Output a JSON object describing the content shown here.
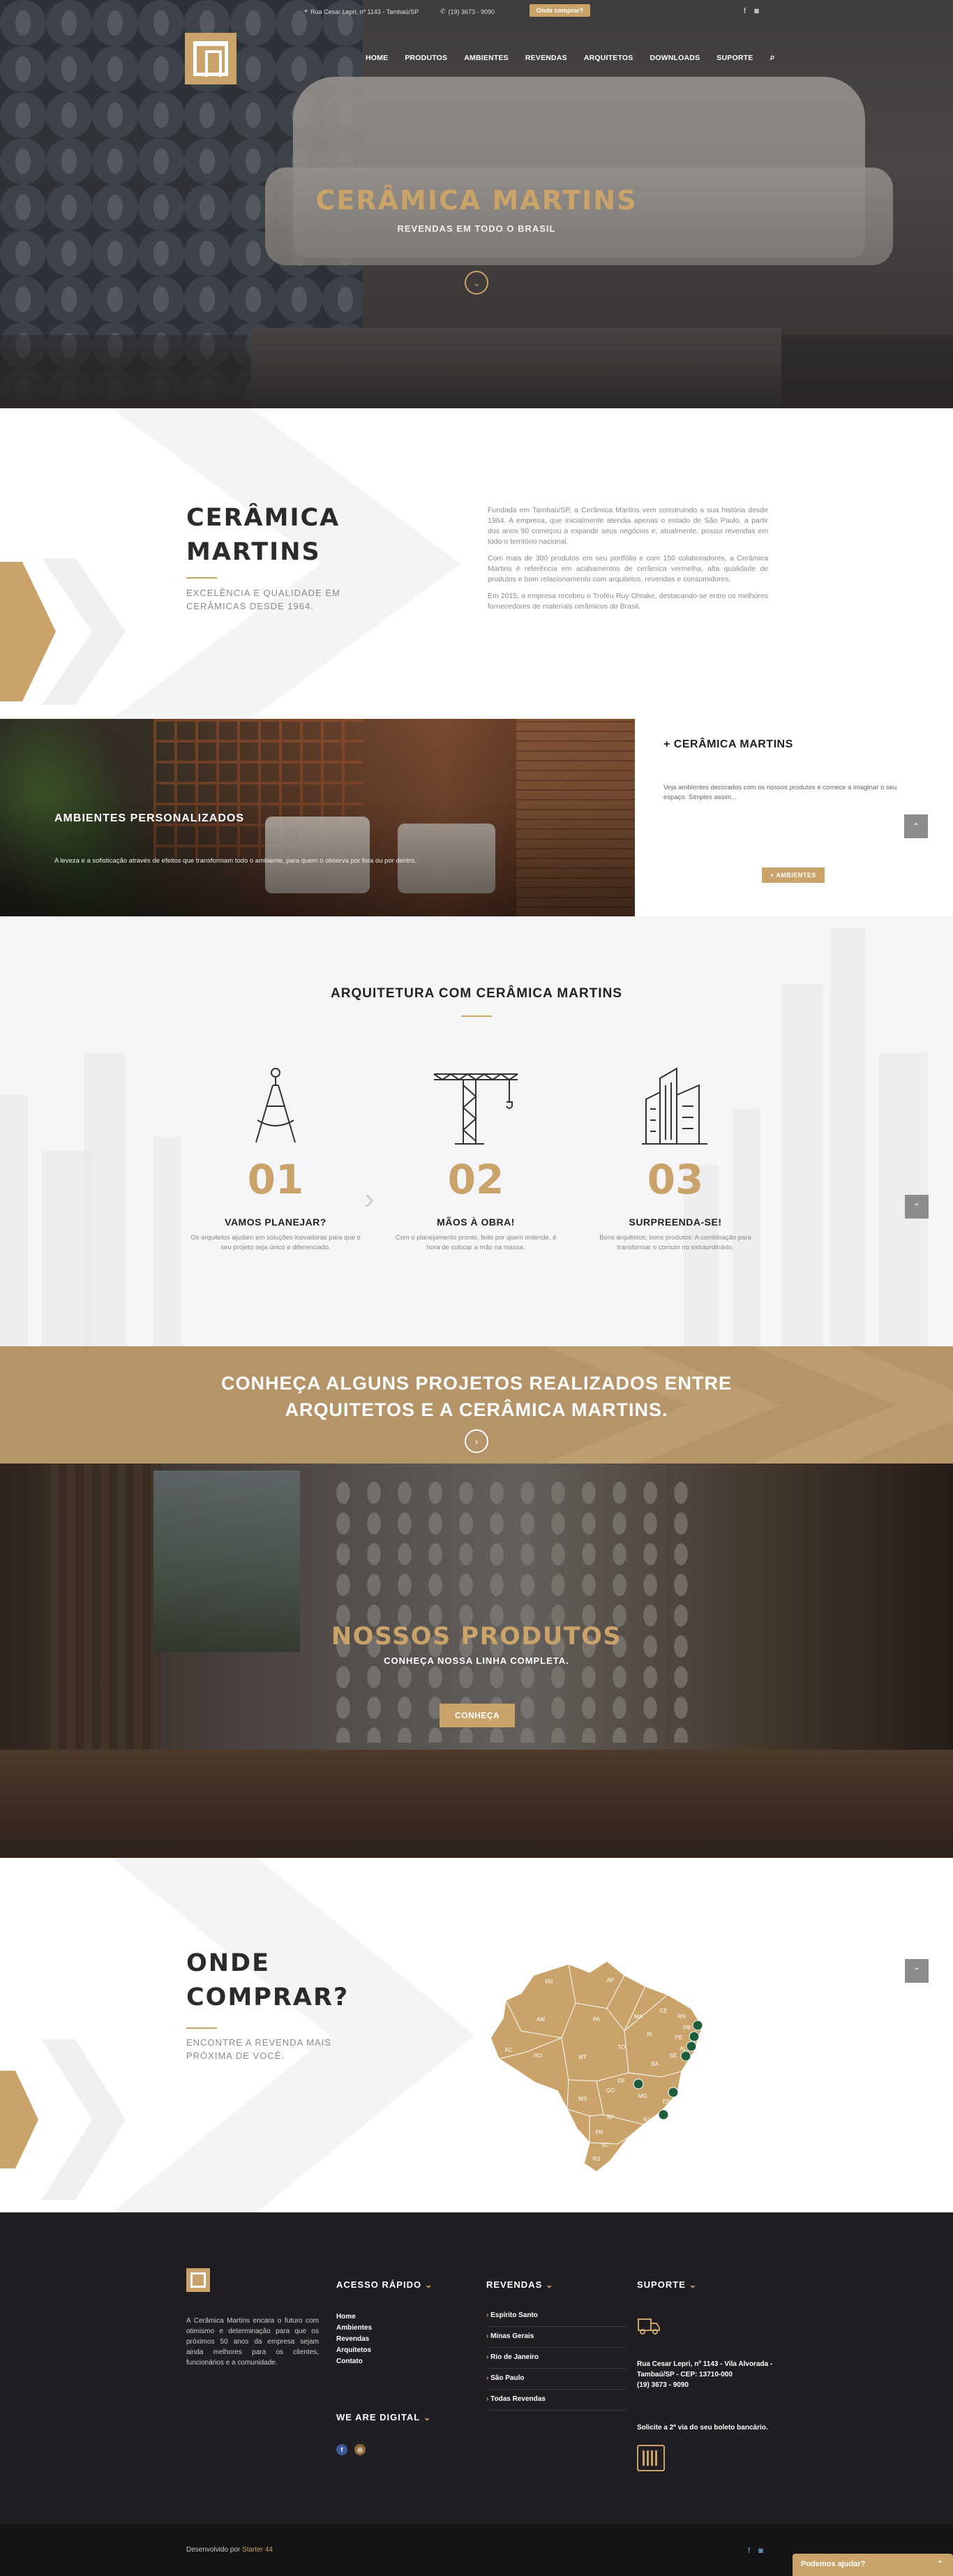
{
  "topbar": {
    "address": "Rua Cesar Lepri, nº 1143 - Tambaú/SP",
    "phone": "(19) 3673 - 9090",
    "buy_button": "Onde comprar?"
  },
  "nav": {
    "items": [
      "HOME",
      "PRODUTOS",
      "AMBIENTES",
      "REVENDAS",
      "ARQUITETOS",
      "DOWNLOADS",
      "SUPORTE"
    ]
  },
  "hero": {
    "title": "CERÂMICA MARTINS",
    "subtitle": "REVENDAS EM TODO O BRASIL"
  },
  "about": {
    "title_line1": "CERÂMICA",
    "title_line2": "MARTINS",
    "tagline": "EXCELÊNCIA E QUALIDADE EM CERÂMICAS DESDE 1964.",
    "paragraphs": [
      "Fundada em Tambaú/SP, a Cerâmica Martins vem construindo a sua história desde 1964. A empresa, que inicialmente atendia apenas o estado de São Paulo, a partir dos anos 90 começou a expandir seus negócios e, atualmente, possui revendas em todo o território nacional.",
      "Com mais de 300 produtos em seu portfólio e com 150 colaboradores, a Cerâmica Martins é referência em acabamentos de cerâmica vermelha, alta qualidade de produtos e bom relacionamento com arquitetos, revendas e consumidores.",
      "Em 2015, a empresa recebeu o Troféu Ruy Ohtake, destacando-se entre os melhores fornecedores de materiais cerâmicos do Brasil."
    ]
  },
  "ambientes": {
    "title": "AMBIENTES PERSONALIZADOS",
    "description": "A leveza e a sofisticação através de efeitos que transformam todo o ambiente, para quem o observa por fora ou por dentro.",
    "panel_title": "+ CERÂMICA MARTINS",
    "panel_text": "Veja ambientes decorados com os nossos produtos e comece a imaginar o seu espaço. Simples assim...",
    "button": "+ AMBIENTES"
  },
  "arquitetura": {
    "title": "ARQUITETURA COM CERÂMICA MARTINS",
    "steps": [
      {
        "num": "01",
        "title": "VAMOS PLANEJAR?",
        "text": "Os arquitetos ajudam em soluções inovadoras para que o seu projeto seja único e diferenciado.",
        "icon": "compass-icon"
      },
      {
        "num": "02",
        "title": "MÃOS À OBRA!",
        "text": "Com o planejamento pronto, feito por quem entende, é hora de colocar a mão na massa.",
        "icon": "crane-icon"
      },
      {
        "num": "03",
        "title": "SURPREENDA-SE!",
        "text": "Bons arquitetos, bons produtos: A combinação para transformar o comum no extraordinário.",
        "icon": "building-icon"
      }
    ]
  },
  "projetos": {
    "title_line1": "CONHEÇA ALGUNS PROJETOS REALIZADOS ENTRE",
    "title_line2": "ARQUITETOS E A CERÂMICA MARTINS."
  },
  "produtos": {
    "title": "NOSSOS PRODUTOS",
    "subtitle": "CONHEÇA NOSSA LINHA COMPLETA.",
    "button": "CONHEÇA"
  },
  "onde": {
    "title_line1": "ONDE",
    "title_line2": "COMPRAR?",
    "subtitle": "ENCONTRE A REVENDA MAIS PRÓXIMA DE VOCÊ.",
    "states": [
      "RR",
      "AP",
      "AM",
      "PA",
      "MA",
      "CE",
      "RN",
      "PB",
      "PE",
      "AL",
      "SE",
      "PI",
      "AC",
      "RO",
      "TO",
      "BA",
      "MT",
      "DF",
      "GO",
      "MG",
      "ES",
      "MS",
      "SP",
      "RJ",
      "PR",
      "SC",
      "RS"
    ]
  },
  "footer": {
    "about": "A Cerâmica Martins encara o futuro com otimismo e determinação para que os próximos 50 anos da empresa sejam ainda melhores para os clientes, funcionários e a comunidade.",
    "acesso_title": "ACESSO RÁPIDO",
    "acesso_links": [
      "Home",
      "Ambientes",
      "Revendas",
      "Arquitetos",
      "Contato"
    ],
    "revendas_title": "REVENDAS",
    "revendas_links": [
      "Espírito Santo",
      "Minas Gerais",
      "Rio de Janeiro",
      "São Paulo",
      "Todas Revendas"
    ],
    "suporte_title": "SUPORTE",
    "address": "Rua Cesar Lepri, nº 1143 - Vila Alvorada - Tambaú/SP - CEP: 13710-000",
    "phone": "(19) 3673 - 9090",
    "boleto": "Solicite a 2ª via do seu boleto bancário.",
    "digital_title": "WE ARE DIGITAL",
    "developed_by": "Desenvolvido por",
    "developer": "Starter 44",
    "chat": "Podemos ajudar?"
  },
  "colors": {
    "gold": "#c9a36a",
    "dark": "#201e22"
  }
}
